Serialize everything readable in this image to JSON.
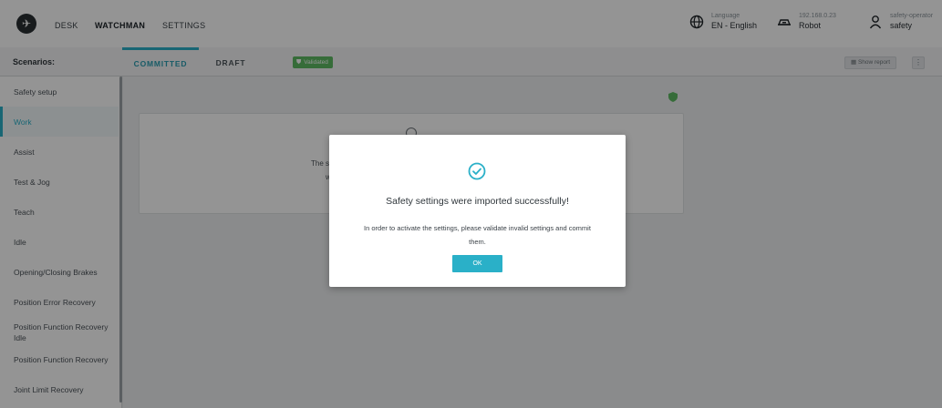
{
  "nav": {
    "desk": "DESK",
    "watchman": "WATCHMAN",
    "settings": "SETTINGS"
  },
  "topright": {
    "language_label": "Language",
    "language_value": "EN - English",
    "ip": "192.168.0.23",
    "robot": "Robot",
    "user_role": "safety-operator",
    "user_name": "safety"
  },
  "subheader": {
    "scenarios_label": "Scenarios:",
    "tab_committed": "COMMITTED",
    "tab_draft": "DRAFT",
    "badge": "Validated",
    "show_report": "Show report",
    "more": "⋮"
  },
  "sidebar": {
    "items": [
      {
        "label": "Safety setup",
        "active": false
      },
      {
        "label": "Work",
        "active": true
      },
      {
        "label": "Assist",
        "active": false
      },
      {
        "label": "Test & Jog",
        "active": false
      },
      {
        "label": "Teach",
        "active": false
      },
      {
        "label": "Idle",
        "active": false
      },
      {
        "label": "Opening/Closing Brakes",
        "active": false
      },
      {
        "label": "Position Error Recovery",
        "active": false
      },
      {
        "label": "Position Function Recovery Idle",
        "active": false
      },
      {
        "label": "Position Function Recovery",
        "active": false
      },
      {
        "label": "Joint Limit Recovery",
        "active": false
      }
    ]
  },
  "card": {
    "line1": "The s",
    "line2": "w"
  },
  "modal": {
    "title": "Safety settings were imported successfully!",
    "body": "In order to activate the settings, please validate invalid settings and commit them.",
    "ok": "OK"
  },
  "colors": {
    "accent": "#2ab0c8",
    "validated": "#5dbb63"
  }
}
